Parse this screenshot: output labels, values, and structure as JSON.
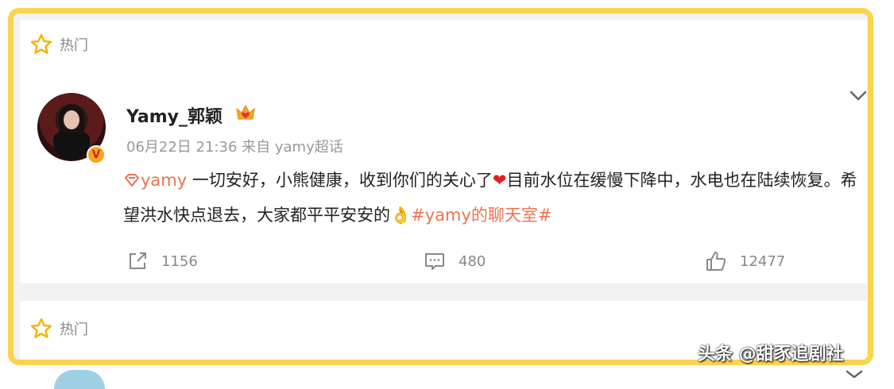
{
  "cards": [
    {
      "hot_label": "热门",
      "user": {
        "name": "Yamy_郭颖",
        "meta": "06月22日 21:36  来自 yamy超话"
      },
      "post": {
        "tag_prefix": "yamy",
        "text_1": " 一切安好，小熊健康，收到你们的关心了",
        "text_2": "目前水位在缓慢下降中，水电也在陆续恢复。希望洪水快点退去，大家都平平安安的",
        "hashtag": "#yamy的聊天室#"
      },
      "actions": {
        "share": "1156",
        "comment": "480",
        "like": "12477"
      }
    },
    {
      "hot_label": "热门"
    }
  ],
  "watermark": "头条 @甜豕追剧社",
  "colors": {
    "frame": "#fcd24f",
    "accent": "#eb7350",
    "muted": "#888888"
  },
  "icons": [
    "star-icon",
    "crown-icon",
    "chevron-down-icon",
    "share-icon",
    "comment-icon",
    "like-icon",
    "heart-emoji",
    "ok-hand-emoji"
  ]
}
